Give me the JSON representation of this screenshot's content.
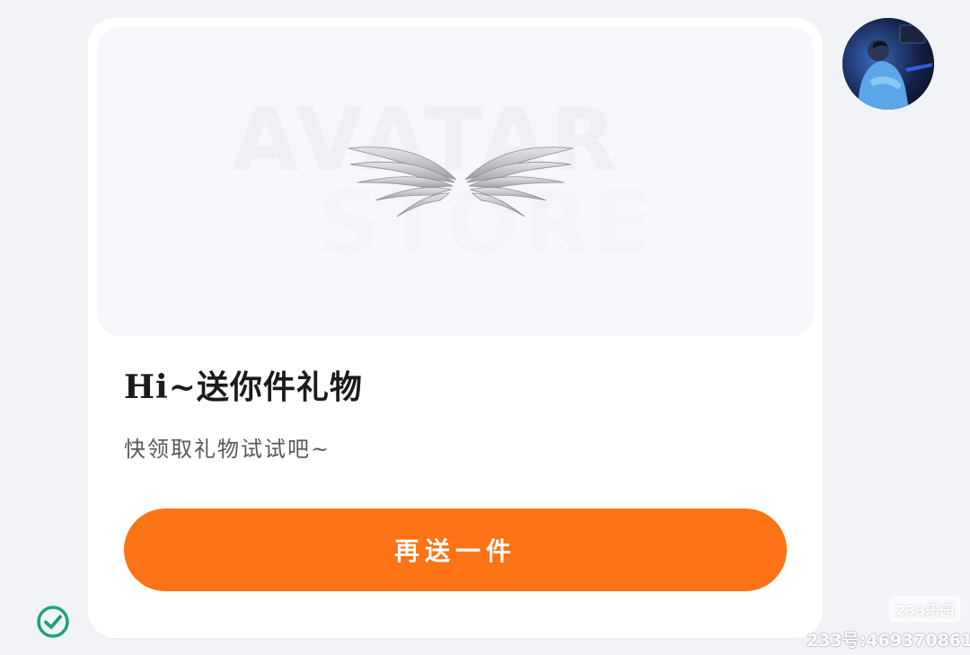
{
  "gift_card": {
    "preview": {
      "watermark_line1": "AVATAR",
      "watermark_line2": "STORE",
      "item_icon": "angel-wings-icon"
    },
    "title": "Hi~送你件礼物",
    "subtitle": "快领取礼物试试吧~",
    "send_button_label": "再送一件"
  },
  "avatar": {
    "icon": "user-avatar"
  },
  "status": {
    "icon": "check-circle-icon",
    "color": "#1aa37a"
  },
  "watermark": {
    "brand": "233乐园",
    "account": "233号:469370861"
  },
  "colors": {
    "accent": "#fd7316",
    "background": "#f2f3f7",
    "card": "#ffffff"
  }
}
